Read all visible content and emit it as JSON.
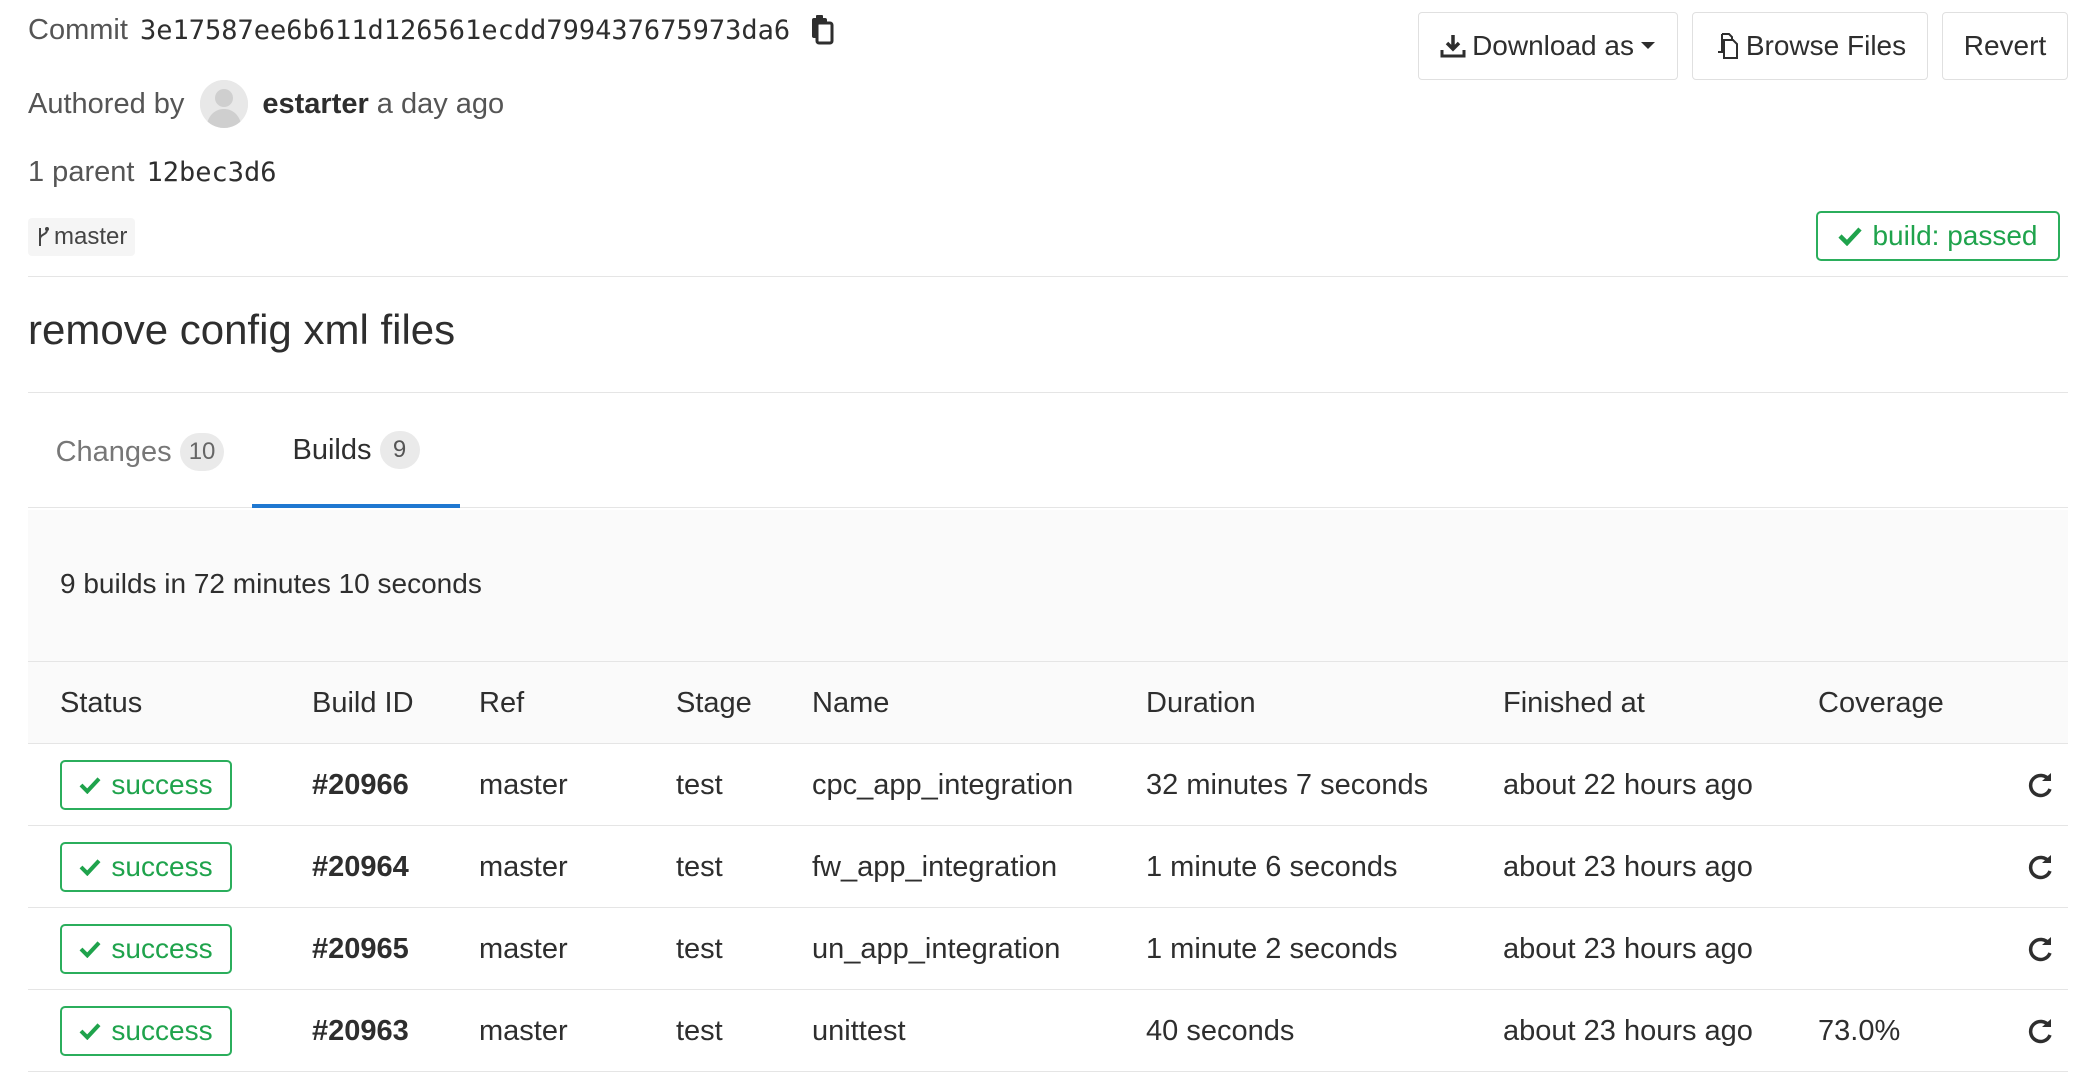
{
  "commit": {
    "label": "Commit",
    "sha": "3e17587ee6b611d126561ecdd799437675973da6",
    "copy_icon": "clipboard-icon"
  },
  "author": {
    "prefix": "Authored by",
    "name": "estarter",
    "time": "a day ago",
    "avatar_icon": "default-avatar"
  },
  "parent": {
    "label": "1 parent",
    "sha": "12bec3d6"
  },
  "branch": {
    "icon": "branch-icon",
    "name": "master"
  },
  "actions": {
    "download_label": "Download as",
    "browse_label": "Browse Files",
    "revert_label": "Revert"
  },
  "build_status": {
    "label": "build: passed",
    "color": "#1fa34c"
  },
  "title": "remove config xml files",
  "tabs": [
    {
      "label": "Changes",
      "count": "10",
      "active": false
    },
    {
      "label": "Builds",
      "count": "9",
      "active": true
    }
  ],
  "summary": "9 builds in 72 minutes 10 seconds",
  "table": {
    "headers": {
      "status": "Status",
      "build_id": "Build ID",
      "ref": "Ref",
      "stage": "Stage",
      "name": "Name",
      "duration": "Duration",
      "finished": "Finished at",
      "coverage": "Coverage"
    },
    "rows": [
      {
        "status": "success",
        "id": "#20966",
        "ref": "master",
        "stage": "test",
        "name": "cpc_app_integration",
        "duration": "32 minutes 7 seconds",
        "finished": "about 22 hours ago",
        "coverage": ""
      },
      {
        "status": "success",
        "id": "#20964",
        "ref": "master",
        "stage": "test",
        "name": "fw_app_integration",
        "duration": "1 minute 6 seconds",
        "finished": "about 23 hours ago",
        "coverage": ""
      },
      {
        "status": "success",
        "id": "#20965",
        "ref": "master",
        "stage": "test",
        "name": "un_app_integration",
        "duration": "1 minute 2 seconds",
        "finished": "about 23 hours ago",
        "coverage": ""
      },
      {
        "status": "success",
        "id": "#20963",
        "ref": "master",
        "stage": "test",
        "name": "unittest",
        "duration": "40 seconds",
        "finished": "about 23 hours ago",
        "coverage": "73.0%"
      }
    ]
  },
  "colors": {
    "success": "#1fa34c",
    "active_tab": "#1f78d1",
    "border": "#e5e5e5"
  }
}
